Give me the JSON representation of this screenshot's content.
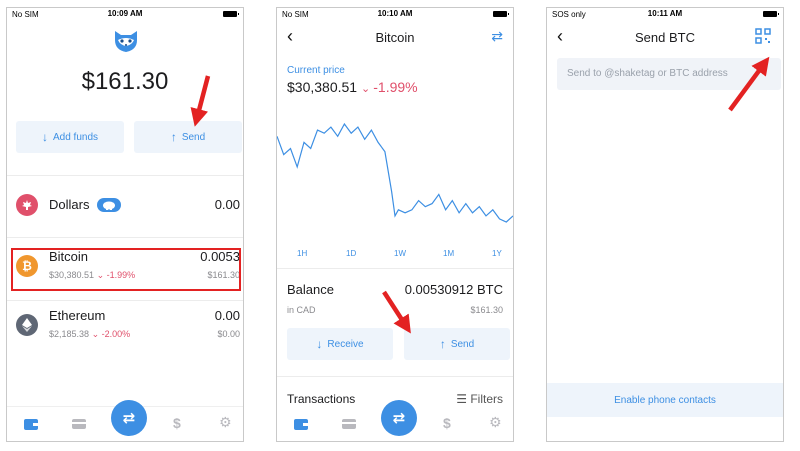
{
  "screens": {
    "home": {
      "status": {
        "carrier": "No SIM",
        "time": "10:09 AM"
      },
      "balance": "$161.30",
      "buttons": {
        "add_funds": "Add funds",
        "send": "Send"
      },
      "accounts": [
        {
          "name": "Dollars",
          "value": "0.00"
        },
        {
          "name": "Bitcoin",
          "value": "0.0053",
          "price": "$30,380.51",
          "change": "-1.99%",
          "fiat": "$161.30"
        },
        {
          "name": "Ethereum",
          "value": "0.00",
          "price": "$2,185.38",
          "change": "-2.00%",
          "fiat": "$0.00"
        }
      ]
    },
    "bitcoin": {
      "status": {
        "carrier": "No SIM",
        "time": "10:10 AM"
      },
      "title": "Bitcoin",
      "current_price_label": "Current price",
      "current_price": "$30,380.51",
      "change": "-1.99%",
      "timeframes": [
        "1H",
        "1D",
        "1W",
        "1M",
        "1Y"
      ],
      "balance_label": "Balance",
      "balance_value": "0.00530912 BTC",
      "in_cad_label": "in CAD",
      "in_cad_value": "$161.30",
      "receive": "Receive",
      "send": "Send",
      "transactions": "Transactions",
      "filters": "Filters"
    },
    "send_btc": {
      "status": {
        "carrier": "SOS only",
        "time": "10:11 AM"
      },
      "title": "Send BTC",
      "input_placeholder": "Send to @shaketag or BTC address",
      "enable_contacts": "Enable phone contacts"
    }
  },
  "colors": {
    "accent": "#3d8fe3",
    "negative": "#e0506b",
    "annotation": "#e32222"
  },
  "icons": [
    "raccoon-logo-icon",
    "wallet-icon",
    "card-icon",
    "swap-icon",
    "dollar-icon",
    "gear-icon",
    "qr-scan-icon",
    "piggy-bank-icon",
    "maple-leaf-icon",
    "bitcoin-icon",
    "ethereum-icon",
    "back-chevron-icon",
    "swap-arrows-icon",
    "filter-icon"
  ],
  "chart_data": {
    "type": "line",
    "title": "",
    "xlabel": "",
    "ylabel": "",
    "x": [
      0,
      1,
      2,
      3,
      4,
      5,
      6,
      7,
      8,
      9,
      10,
      11,
      12,
      13,
      14,
      15,
      16,
      17,
      17.5,
      18,
      19,
      20,
      21,
      22,
      23,
      24,
      25,
      26,
      27,
      28,
      29,
      30,
      31,
      32,
      33,
      34,
      35
    ],
    "series": [
      {
        "name": "",
        "values": [
          31200,
          30900,
          31000,
          30700,
          31100,
          31000,
          31300,
          31250,
          31350,
          31200,
          31400,
          31250,
          31350,
          31150,
          31300,
          31100,
          30950,
          30300,
          29900,
          30000,
          29950,
          30000,
          30150,
          30050,
          30100,
          30250,
          30000,
          30150,
          29950,
          30100,
          29950,
          30050,
          29900,
          30000,
          29850,
          29800,
          29900
        ]
      }
    ]
  }
}
